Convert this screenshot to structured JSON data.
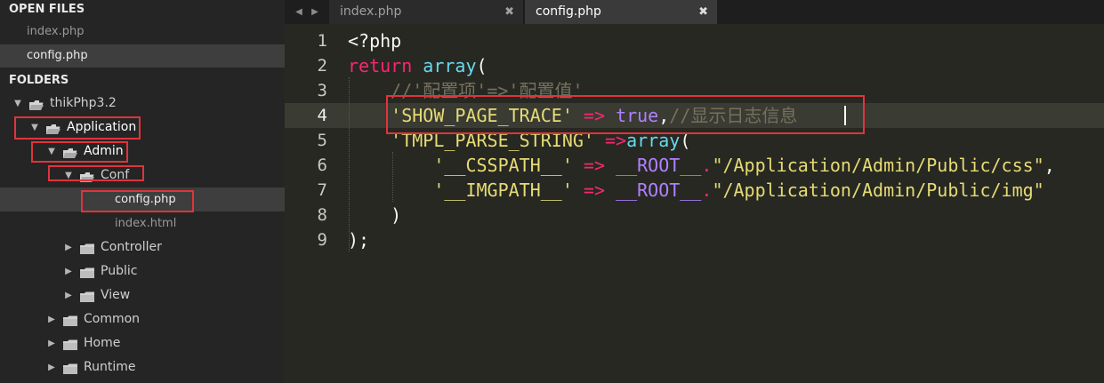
{
  "sidebar": {
    "open_files_header": "OPEN FILES",
    "open_files": [
      {
        "name": "index.php",
        "active": false
      },
      {
        "name": "config.php",
        "active": true
      }
    ],
    "folders_header": "FOLDERS",
    "tree": [
      {
        "label": "thikPhp3.2",
        "kind": "folder",
        "expanded": true
      },
      {
        "label": "Application",
        "kind": "folder",
        "expanded": true
      },
      {
        "label": "Admin",
        "kind": "folder",
        "expanded": true
      },
      {
        "label": "Conf",
        "kind": "folder",
        "expanded": true
      },
      {
        "label": "config.php",
        "kind": "file",
        "selected": true
      },
      {
        "label": "index.html",
        "kind": "file"
      },
      {
        "label": "Controller",
        "kind": "folder",
        "expanded": false
      },
      {
        "label": "Public",
        "kind": "folder",
        "expanded": false
      },
      {
        "label": "View",
        "kind": "folder",
        "expanded": false
      },
      {
        "label": "Common",
        "kind": "folder",
        "expanded": false
      },
      {
        "label": "Home",
        "kind": "folder",
        "expanded": false
      },
      {
        "label": "Runtime",
        "kind": "folder",
        "expanded": false
      }
    ],
    "icons": {
      "expanded_arrow": "triangle-down-icon",
      "collapsed_arrow": "triangle-right-icon",
      "folder_open": "folder-open-icon",
      "folder_closed": "folder-icon"
    }
  },
  "tabbar": {
    "icons": {
      "prev": "tab-prev-arrow-icon",
      "next": "tab-next-arrow-icon",
      "close": "close-icon"
    },
    "tabs": [
      {
        "label": "index.php",
        "close": "✖",
        "active": false
      },
      {
        "label": "config.php",
        "close": "✖",
        "active": true
      }
    ]
  },
  "editor": {
    "current_line": 4,
    "lines": [
      {
        "num": "1",
        "tokens": [
          {
            "t": "<?php",
            "c": "plain"
          }
        ]
      },
      {
        "num": "2",
        "tokens": [
          {
            "t": "return",
            "c": "keyword"
          },
          {
            "t": " ",
            "c": "plain"
          },
          {
            "t": "array",
            "c": "func"
          },
          {
            "t": "(",
            "c": "plain"
          }
        ]
      },
      {
        "num": "3",
        "tokens": [
          {
            "t": "    //'配置项'=>'配置值'",
            "c": "comment"
          }
        ]
      },
      {
        "num": "4",
        "tokens": [
          {
            "t": "    ",
            "c": "plain"
          },
          {
            "t": "'SHOW_PAGE_TRACE'",
            "c": "string"
          },
          {
            "t": " ",
            "c": "plain"
          },
          {
            "t": "=>",
            "c": "op"
          },
          {
            "t": " ",
            "c": "plain"
          },
          {
            "t": "true",
            "c": "const"
          },
          {
            "t": ",",
            "c": "plain"
          },
          {
            "t": "//显示日志信息",
            "c": "comment"
          }
        ]
      },
      {
        "num": "5",
        "tokens": [
          {
            "t": "    ",
            "c": "plain"
          },
          {
            "t": "'TMPL_PARSE_STRING'",
            "c": "string"
          },
          {
            "t": " ",
            "c": "plain"
          },
          {
            "t": "=>",
            "c": "op"
          },
          {
            "t": "array",
            "c": "func"
          },
          {
            "t": "(",
            "c": "plain"
          }
        ]
      },
      {
        "num": "6",
        "tokens": [
          {
            "t": "        ",
            "c": "plain"
          },
          {
            "t": "'__CSSPATH__'",
            "c": "string"
          },
          {
            "t": " ",
            "c": "plain"
          },
          {
            "t": "=>",
            "c": "op"
          },
          {
            "t": " ",
            "c": "plain"
          },
          {
            "t": "__ROOT__",
            "c": "const"
          },
          {
            "t": ".",
            "c": "op"
          },
          {
            "t": "\"/Application/Admin/Public/css\"",
            "c": "string"
          },
          {
            "t": ",",
            "c": "plain"
          }
        ]
      },
      {
        "num": "7",
        "tokens": [
          {
            "t": "        ",
            "c": "plain"
          },
          {
            "t": "'__IMGPATH__'",
            "c": "string"
          },
          {
            "t": " ",
            "c": "plain"
          },
          {
            "t": "=>",
            "c": "op"
          },
          {
            "t": " ",
            "c": "plain"
          },
          {
            "t": "__ROOT__",
            "c": "const"
          },
          {
            "t": ".",
            "c": "op"
          },
          {
            "t": "\"/Application/Admin/Public/img\"",
            "c": "string"
          }
        ]
      },
      {
        "num": "8",
        "tokens": [
          {
            "t": "    )",
            "c": "plain"
          }
        ]
      },
      {
        "num": "9",
        "tokens": [
          {
            "t": ");",
            "c": "plain"
          }
        ]
      }
    ]
  },
  "colors": {
    "sidebar_bg": "#252525",
    "editor_bg": "#272822",
    "highlight_box": "#e0343b",
    "keyword": "#f92672",
    "string": "#e6db74",
    "func": "#66d9ef",
    "const": "#ae81ff",
    "comment": "#75715e"
  }
}
